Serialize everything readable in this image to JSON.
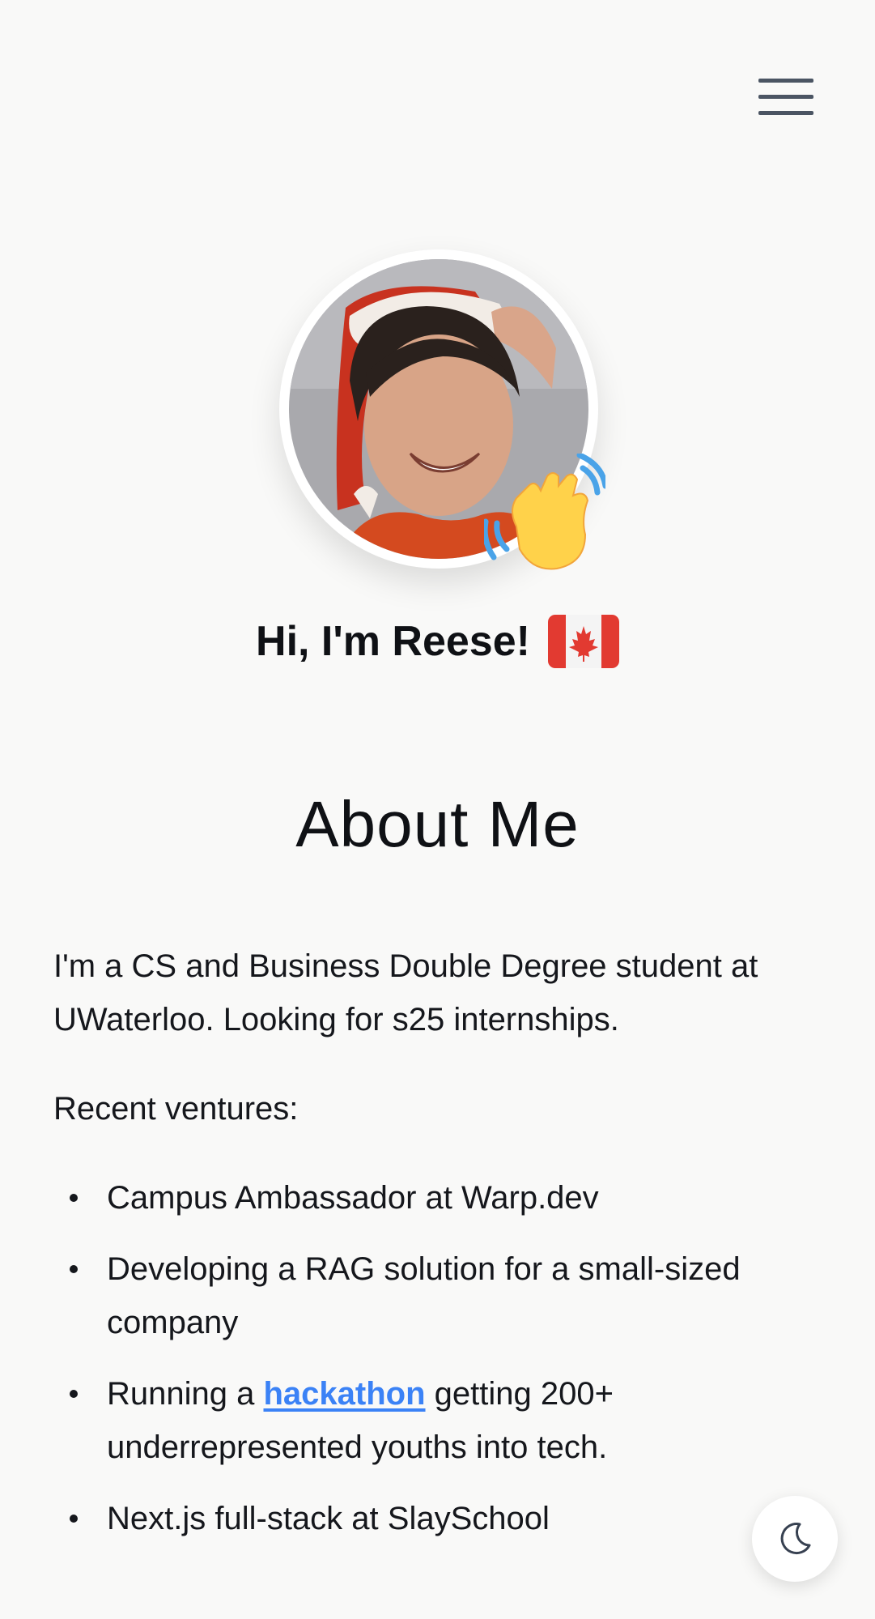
{
  "header": {
    "menu_icon": "hamburger-menu-icon"
  },
  "hero": {
    "avatar_icon": "profile-photo",
    "wave_icon": "waving-hand-emoji",
    "greeting": "Hi, I'm Reese!",
    "flag_icon": "canada-flag-emoji"
  },
  "about": {
    "heading": "About Me",
    "intro": "I'm a CS and Business Double Degree student at UWaterloo. Looking for s25 internships.",
    "ventures_label": "Recent ventures:",
    "ventures": [
      {
        "text": "Campus Ambassador at Warp.dev"
      },
      {
        "text": "Developing a RAG solution for a small-sized company"
      },
      {
        "prefix": "Running a ",
        "link": "hackathon",
        "suffix": " getting 200+ underrepresented youths into tech."
      },
      {
        "text": "Next.js full-stack at SlaySchool"
      }
    ]
  },
  "theme_toggle": {
    "icon": "moon-icon"
  },
  "colors": {
    "background": "#f9f9f8",
    "link": "#3b82f6",
    "text": "#111318",
    "menu": "#4b5563"
  }
}
